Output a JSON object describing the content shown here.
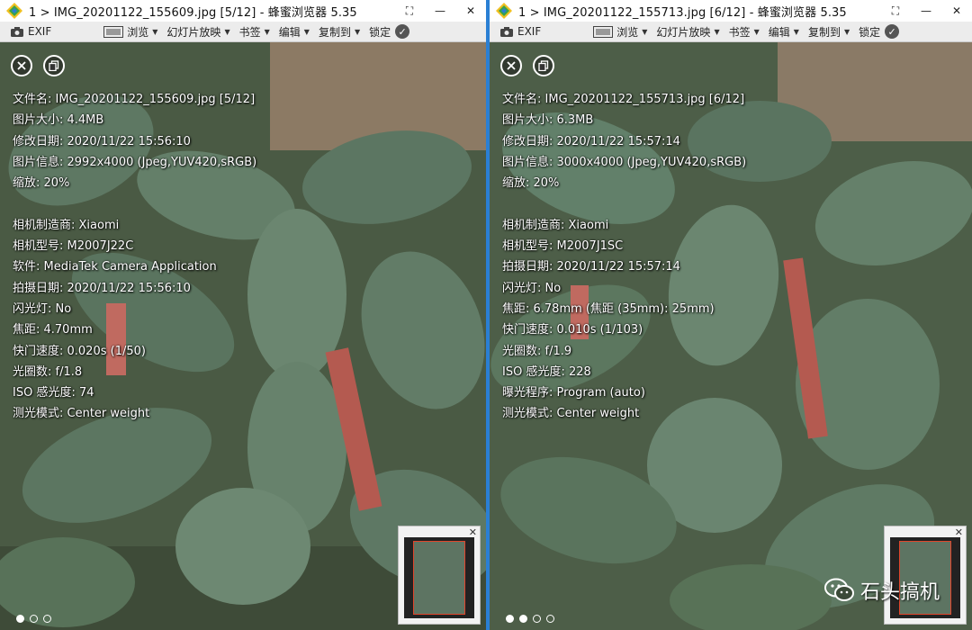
{
  "app_name": "蜂蜜浏览器",
  "colors": {
    "accent": "#2a7fd4",
    "thumb_frame": "#e0452b"
  },
  "toolbar": {
    "exif": "EXIF",
    "browse": "浏览",
    "slideshow": "幻灯片放映",
    "bookmark": "书签",
    "edit": "编辑",
    "copy_to": "复制到",
    "lock": "锁定"
  },
  "windows": [
    {
      "title": "1 > IMG_20201122_155609.jpg [5/12] - 蜂蜜浏览器 5.35",
      "exif_lines": [
        "文件名: IMG_20201122_155609.jpg [5/12]",
        "图片大小: 4.4MB",
        "修改日期: 2020/11/22 15:56:10",
        "图片信息: 2992x4000 (Jpeg,YUV420,sRGB)",
        "缩放: 20%",
        "",
        "相机制造商: Xiaomi",
        "相机型号: M2007J22C",
        "软件: MediaTek Camera Application",
        "拍摄日期: 2020/11/22 15:56:10",
        "闪光灯: No",
        "焦距: 4.70mm",
        "快门速度: 0.020s (1/50)",
        "光圈数: f/1.8",
        "ISO 感光度: 74",
        "测光模式: Center weight"
      ],
      "active_dot": 0
    },
    {
      "title": "1 > IMG_20201122_155713.jpg [6/12] - 蜂蜜浏览器 5.35",
      "exif_lines": [
        "文件名: IMG_20201122_155713.jpg [6/12]",
        "图片大小: 6.3MB",
        "修改日期: 2020/11/22 15:57:14",
        "图片信息: 3000x4000 (Jpeg,YUV420,sRGB)",
        "缩放: 20%",
        "",
        "相机制造商: Xiaomi",
        "相机型号: M2007J1SC",
        "拍摄日期: 2020/11/22 15:57:14",
        "闪光灯: No",
        "焦距: 6.78mm (焦距 (35mm): 25mm)",
        "快门速度: 0.010s (1/103)",
        "光圈数: f/1.9",
        "ISO 感光度: 228",
        "曝光程序: Program (auto)",
        "测光模式: Center weight"
      ],
      "active_dot": 1
    }
  ],
  "watermark": "石头搞机",
  "icons": {
    "close": "close-icon",
    "copy": "copy-icon",
    "camera": "camera-icon",
    "check": "check-icon",
    "wechat": "wechat-icon"
  }
}
